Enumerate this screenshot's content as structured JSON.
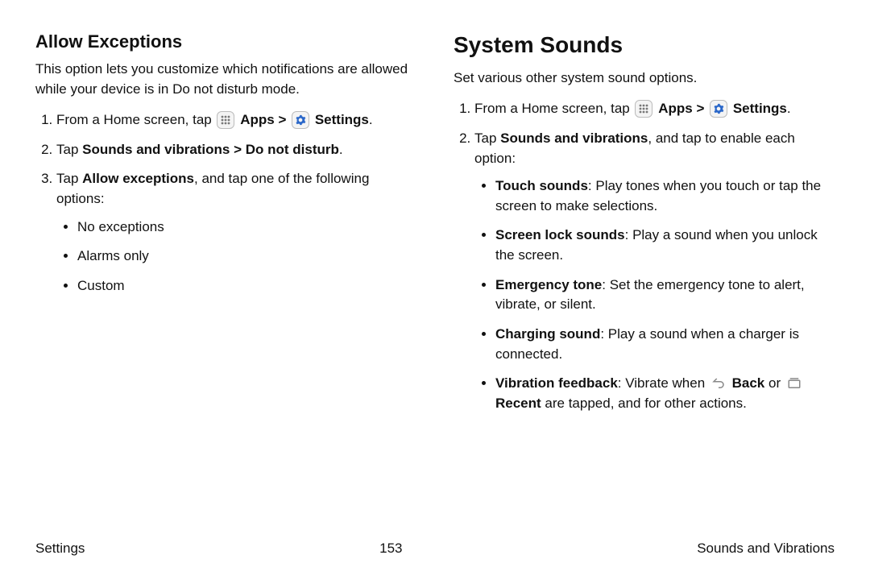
{
  "left": {
    "heading": "Allow Exceptions",
    "intro": "This option lets you customize which notifications are allowed while your device is in Do not disturb mode.",
    "step1_pre": "From a Home screen, tap ",
    "apps_label": "Apps",
    "settings_label": "Settings",
    "step2_pre": "Tap ",
    "step2_bold": "Sounds and vibrations > Do not disturb",
    "step3_pre": "Tap ",
    "step3_bold": "Allow exceptions",
    "step3_post": ", and tap one of the following options:",
    "opts": [
      "No exceptions",
      "Alarms only",
      "Custom"
    ]
  },
  "right": {
    "heading": "System Sounds",
    "intro": "Set various other system sound options.",
    "step1_pre": "From a Home screen, tap ",
    "apps_label": "Apps",
    "settings_label": "Settings",
    "step2_pre": "Tap ",
    "step2_bold": "Sounds and vibrations",
    "step2_post": ", and tap to enable each option:",
    "bullets": [
      {
        "bold": "Touch sounds",
        "rest": ": Play tones when you touch or tap the screen to make selections."
      },
      {
        "bold": "Screen lock sounds",
        "rest": ": Play a sound when you unlock the screen."
      },
      {
        "bold": "Emergency tone",
        "rest": ": Set the emergency tone to alert, vibrate, or silent."
      },
      {
        "bold": "Charging sound",
        "rest": ": Play a sound when a charger is connected."
      }
    ],
    "vib_bold": "Vibration feedback",
    "vib_mid1": ": Vibrate when ",
    "vib_back": "Back",
    "vib_mid2": " or ",
    "vib_recent": "Recent",
    "vib_end": " are tapped, and for other actions."
  },
  "footer": {
    "left": "Settings",
    "center": "153",
    "right": "Sounds and Vibrations"
  },
  "glyphs": {
    "chevron": " > "
  }
}
